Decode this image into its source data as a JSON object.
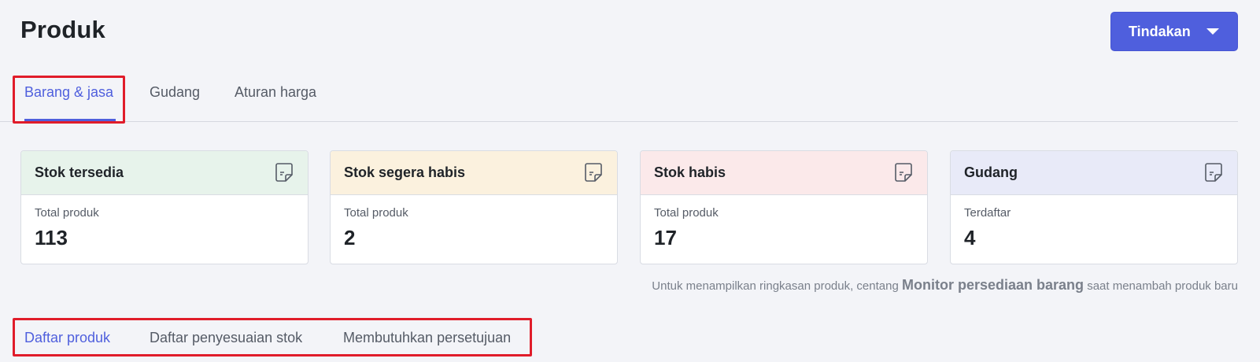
{
  "header": {
    "title": "Produk",
    "action_label": "Tindakan"
  },
  "main_tabs": [
    {
      "label": "Barang & jasa",
      "active": true
    },
    {
      "label": "Gudang",
      "active": false
    },
    {
      "label": "Aturan harga",
      "active": false
    }
  ],
  "cards": [
    {
      "title": "Stok tersedia",
      "subtitle": "Total produk",
      "value": "113",
      "color": "#e7f3eb",
      "icon": "report-icon"
    },
    {
      "title": "Stok segera habis",
      "subtitle": "Total produk",
      "value": "2",
      "color": "#fbf1de",
      "icon": "report-icon"
    },
    {
      "title": "Stok habis",
      "subtitle": "Total produk",
      "value": "17",
      "color": "#fbe9ea",
      "icon": "report-icon"
    },
    {
      "title": "Gudang",
      "subtitle": "Terdaftar",
      "value": "4",
      "color": "#e8eaf8",
      "icon": "report-icon"
    }
  ],
  "hint": {
    "prefix": "Untuk menampilkan ringkasan produk, centang",
    "emphasis": "Monitor persediaan barang",
    "suffix": "saat menambah produk baru"
  },
  "sub_tabs": [
    {
      "label": "Daftar produk",
      "active": true
    },
    {
      "label": "Daftar penyesuaian stok",
      "active": false
    },
    {
      "label": "Membutuhkan persetujuan",
      "active": false
    }
  ],
  "colors": {
    "accent": "#4f5fdd",
    "highlight": "#e01c2a",
    "background": "#f3f4f8"
  }
}
